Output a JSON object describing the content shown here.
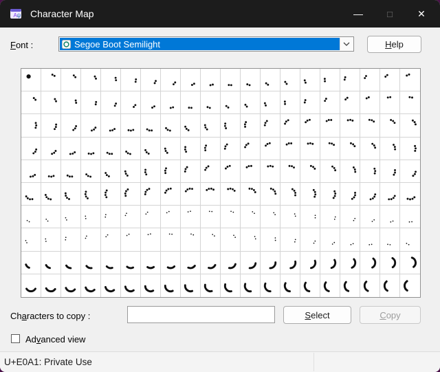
{
  "window": {
    "title": "Character Map"
  },
  "titlebar": {
    "minimize_glyph": "—",
    "maximize_glyph": "□",
    "close_glyph": "✕"
  },
  "font_row": {
    "label": "Font :",
    "access_key": "F",
    "selected_font": "Segoe Boot Semilight",
    "font_type_icon": "opentype-icon",
    "help_label": "Help",
    "help_access_key": "H"
  },
  "grid": {
    "rows": 10,
    "cols": 20,
    "start_codepoint": "U+E000",
    "glyph_color": "#111111"
  },
  "copy_row": {
    "label": "Characters to copy :",
    "access_key": "a",
    "input_value": "",
    "select_label": "Select",
    "select_access_key": "S",
    "copy_label": "Copy",
    "copy_access_key": "C",
    "copy_enabled": false
  },
  "advanced_view": {
    "label": "Advanced view",
    "access_key": "v",
    "checked": false
  },
  "status_bar": {
    "selected_char_info": "U+E0A1: Private Use"
  },
  "colors": {
    "titlebar_bg": "#1c1c1c",
    "accent_selection": "#0078d7",
    "desktop_bg": "#4a1149"
  }
}
